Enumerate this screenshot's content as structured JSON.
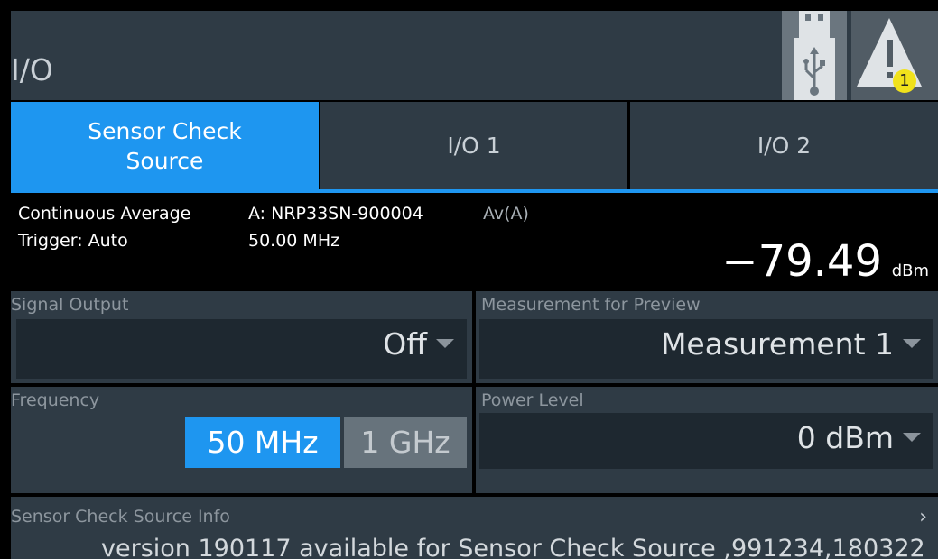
{
  "header": {
    "title": "I/O",
    "alert_count": "1",
    "icons": [
      "usb-icon",
      "warning-icon"
    ]
  },
  "tabs": [
    {
      "line1": "Sensor Check",
      "line2": "Source",
      "active": true
    },
    {
      "label": "I/O 1",
      "active": false
    },
    {
      "label": "I/O 2",
      "active": false
    }
  ],
  "status": {
    "mode": "Continuous Average",
    "trigger": "Trigger: Auto",
    "sensor": "A: NRP33SN-900004",
    "frequency": "50.00 MHz",
    "measure_label": "Av(A)",
    "value": "−79.49",
    "unit": "dBm"
  },
  "signal_output": {
    "label": "Signal Output",
    "value": "Off"
  },
  "measurement_preview": {
    "label": "Measurement for Preview",
    "value": "Measurement 1"
  },
  "frequency": {
    "label": "Frequency",
    "options": [
      "50 MHz",
      "1 GHz"
    ],
    "selected": "50 MHz"
  },
  "power_level": {
    "label": "Power Level",
    "value": "0 dBm"
  },
  "info": {
    "label": "Sensor Check Source Info",
    "text": "version 190117 available for Sensor Check Source ,991234,180322"
  },
  "colors": {
    "accent": "#1e96f0",
    "panel": "#2f3b45",
    "field": "#1e2830",
    "alert_badge": "#f1e21b"
  }
}
